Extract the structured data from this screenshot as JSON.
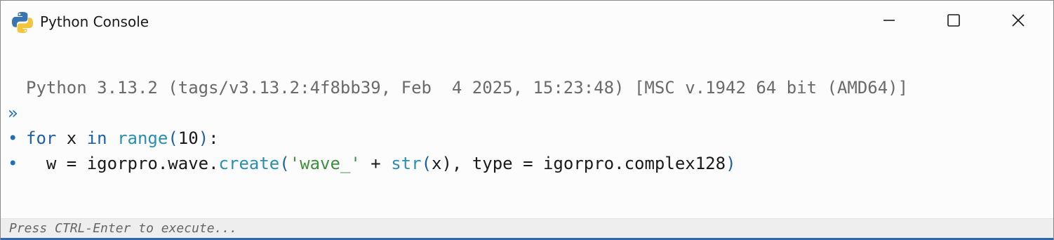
{
  "window": {
    "title": "Python Console",
    "app_icon": "python-logo-icon",
    "controls": {
      "minimize_icon": "minimize-icon",
      "maximize_icon": "maximize-icon",
      "close_icon": "close-icon"
    }
  },
  "console": {
    "banner": "Python 3.13.2 (tags/v3.13.2:4f8bb39, Feb  4 2025, 15:23:48) [MSC v.1942 64 bit (AMD64)]",
    "prompt_symbol": "»",
    "continuation_symbol": "•",
    "lines": [
      {
        "tokens": [
          "for",
          " x ",
          "in",
          " ",
          "range",
          "(",
          "10",
          ")",
          ":"
        ]
      },
      {
        "tokens": [
          "  w = igorpro.wave.",
          "create",
          "(",
          "'wave_'",
          " + ",
          "str",
          "(",
          "x",
          "), type = igorpro.complex128",
          ")"
        ]
      },
      {
        "tokens": []
      }
    ]
  },
  "status": {
    "hint": "Press CTRL-Enter to execute..."
  },
  "colors": {
    "keyword": "#1f5fa8",
    "builtin": "#2a8fb0",
    "string": "#3f8f3f",
    "banner": "#6a6a6a",
    "accent": "#2f68b5"
  }
}
